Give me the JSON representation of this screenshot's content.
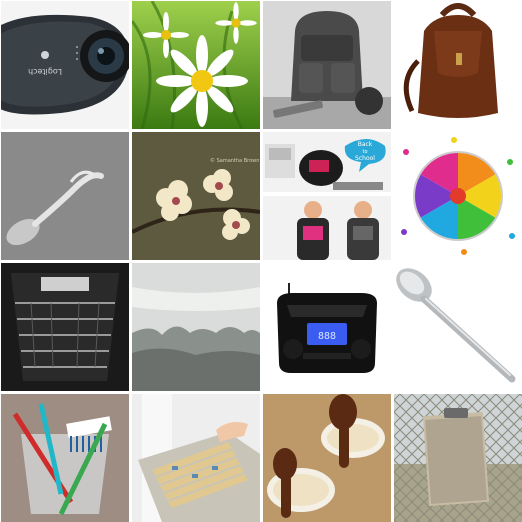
{
  "grid": {
    "tiles": [
      {
        "subject": "webcam",
        "brand_text": "Logitech"
      },
      {
        "subject": "daisy"
      },
      {
        "subject": "backpack-gray"
      },
      {
        "subject": "leather-backpack"
      },
      {
        "subject": "glass-spoon"
      },
      {
        "subject": "cherry-blossom",
        "watermark": "© Samantha Brown"
      },
      {
        "subject": "back-to-school-bags",
        "bubble_text_1": "Back",
        "bubble_text_2": "to",
        "bubble_text_3": "School"
      },
      {
        "subject": "push-pins-rainbow"
      },
      {
        "subject": "oven-interior"
      },
      {
        "subject": "misty-window"
      },
      {
        "subject": "boombox",
        "display_text": "888"
      },
      {
        "subject": "metal-spoon"
      },
      {
        "subject": "toothbrush"
      },
      {
        "subject": "file-drawer"
      },
      {
        "subject": "chocolate-spoons"
      },
      {
        "subject": "clipboard-fence"
      }
    ]
  }
}
